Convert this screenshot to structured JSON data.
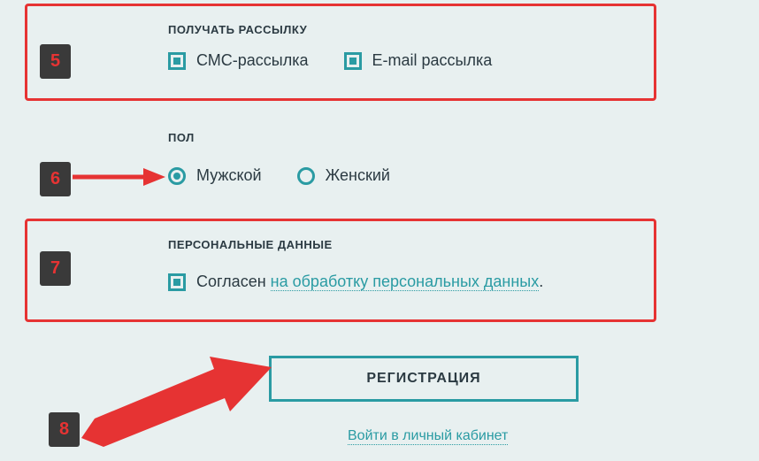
{
  "annotations": {
    "box5": "5",
    "box6": "6",
    "box7": "7",
    "box8": "8"
  },
  "newsletter": {
    "heading": "ПОЛУЧАТЬ РАССЫЛКУ",
    "sms_label": "СМС-рассылка",
    "email_label": "E-mail рассылка"
  },
  "gender": {
    "heading": "ПОЛ",
    "male_label": "Мужской",
    "female_label": "Женский"
  },
  "personal": {
    "heading": "ПЕРСОНАЛЬНЫЕ ДАННЫЕ",
    "consent_prefix": "Согласен ",
    "consent_link": "на обработку персональных данных",
    "consent_suffix": "."
  },
  "actions": {
    "register_label": "РЕГИСТРАЦИЯ",
    "login_label": "Войти в личный кабинет"
  }
}
